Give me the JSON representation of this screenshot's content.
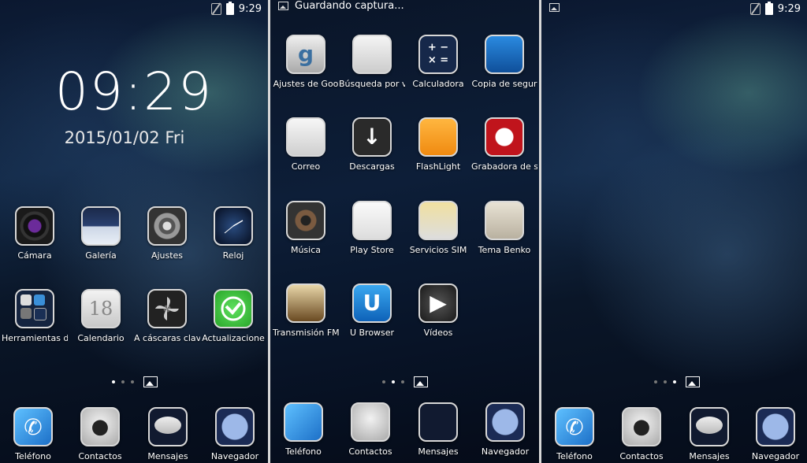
{
  "status": {
    "time": "9:29",
    "saving_text": "Guardando captura..."
  },
  "lockscreen": {
    "clock": "09:29",
    "date": "2015/01/02 Fri"
  },
  "home1_apps": [
    {
      "label": "Cámara",
      "icon": "camera-icon"
    },
    {
      "label": "Galería",
      "icon": "gallery-icon"
    },
    {
      "label": "Ajustes",
      "icon": "settings-gear-icon"
    },
    {
      "label": "Reloj",
      "icon": "clock-icon"
    },
    {
      "label": "Herramientas de",
      "icon": "folder-tools-icon"
    },
    {
      "label": "Calendario",
      "icon": "calendar-icon",
      "text": "18"
    },
    {
      "label": "A cáscaras clav",
      "icon": "pinwheel-icon"
    },
    {
      "label": "Actualizacione",
      "icon": "update-icon"
    }
  ],
  "drawer_apps": [
    {
      "label": "Ajustes de Goo",
      "icon": "google-settings-icon",
      "text": "g"
    },
    {
      "label": "Búsqueda por v",
      "icon": "voice-search-icon"
    },
    {
      "label": "Calculadora",
      "icon": "calculator-icon",
      "text": "+ −\n× ="
    },
    {
      "label": "Copia de segur",
      "icon": "backup-clock-icon"
    },
    {
      "label": "Correo",
      "icon": "mail-icon"
    },
    {
      "label": "Descargas",
      "icon": "download-icon",
      "text": "↓"
    },
    {
      "label": "FlashLight",
      "icon": "flashlight-icon"
    },
    {
      "label": "Grabadora de s",
      "icon": "recorder-icon"
    },
    {
      "label": "Música",
      "icon": "music-speaker-icon"
    },
    {
      "label": "Play Store",
      "icon": "play-store-icon"
    },
    {
      "label": "Servicios SIM",
      "icon": "sim-card-icon"
    },
    {
      "label": "Tema Benko",
      "icon": "theme-palette-icon"
    },
    {
      "label": "Transmisión FM",
      "icon": "fm-radio-icon"
    },
    {
      "label": "U Browser",
      "icon": "u-browser-icon",
      "text": "U"
    },
    {
      "label": "Vídeos",
      "icon": "video-play-icon",
      "text": "▶"
    }
  ],
  "dock": [
    {
      "label": "Teléfono",
      "icon": "phone-icon"
    },
    {
      "label": "Contactos",
      "icon": "contacts-icon"
    },
    {
      "label": "Mensajes",
      "icon": "messages-icon"
    },
    {
      "label": "Navegador",
      "icon": "browser-globe-icon"
    }
  ],
  "colors": {
    "phone_blue": "#1d8fe0",
    "flash_orange": "#f59a1a",
    "update_green": "#3cc23c",
    "recorder_red": "#c0141c"
  }
}
